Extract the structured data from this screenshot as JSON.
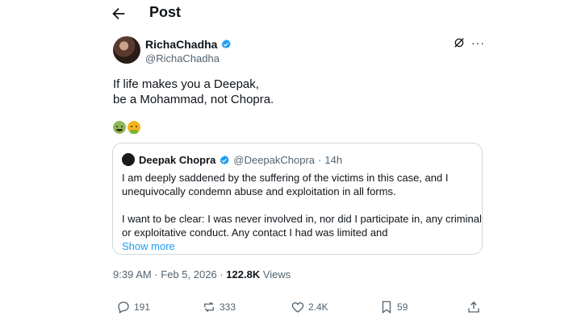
{
  "header": {
    "title": "Post",
    "back_icon": "arrow-left-icon"
  },
  "author": {
    "display_name": "RichaChadha",
    "handle": "@RichaChadha",
    "verified": true,
    "verified_color": "#1d9bf0"
  },
  "post": {
    "lines": [
      "If life makes you a Deepak,",
      "be a Mohammad, not Chopra."
    ],
    "emojis": [
      "nauseated-face-emoji",
      "vomiting-face-emoji"
    ]
  },
  "quote": {
    "display_name": "Deepak Chopra",
    "handle": "@DeepakChopra",
    "separator": "·",
    "time": "14h",
    "paragraph1": [
      "I am deeply saddened by the suffering of the victims in this case, and I",
      "unequivocally condemn abuse and exploitation in all forms."
    ],
    "paragraph2": [
      "I want to be clear: I was never involved in, nor did I participate in, any criminal",
      "or exploitative conduct. Any contact I had was limited and"
    ],
    "show_more": "Show more"
  },
  "meta": {
    "time": "9:39 AM",
    "dot1": "·",
    "date": "Feb 5, 2026",
    "dot2": "·",
    "views_count": "122.8K",
    "views_label": "Views"
  },
  "actions": {
    "replies": "191",
    "reposts": "333",
    "likes": "2.4K",
    "bookmarks": "59"
  },
  "colors": {
    "text": "#0f1419",
    "secondary": "#536471",
    "accent": "#1d9bf0",
    "border": "#cfd9de"
  }
}
